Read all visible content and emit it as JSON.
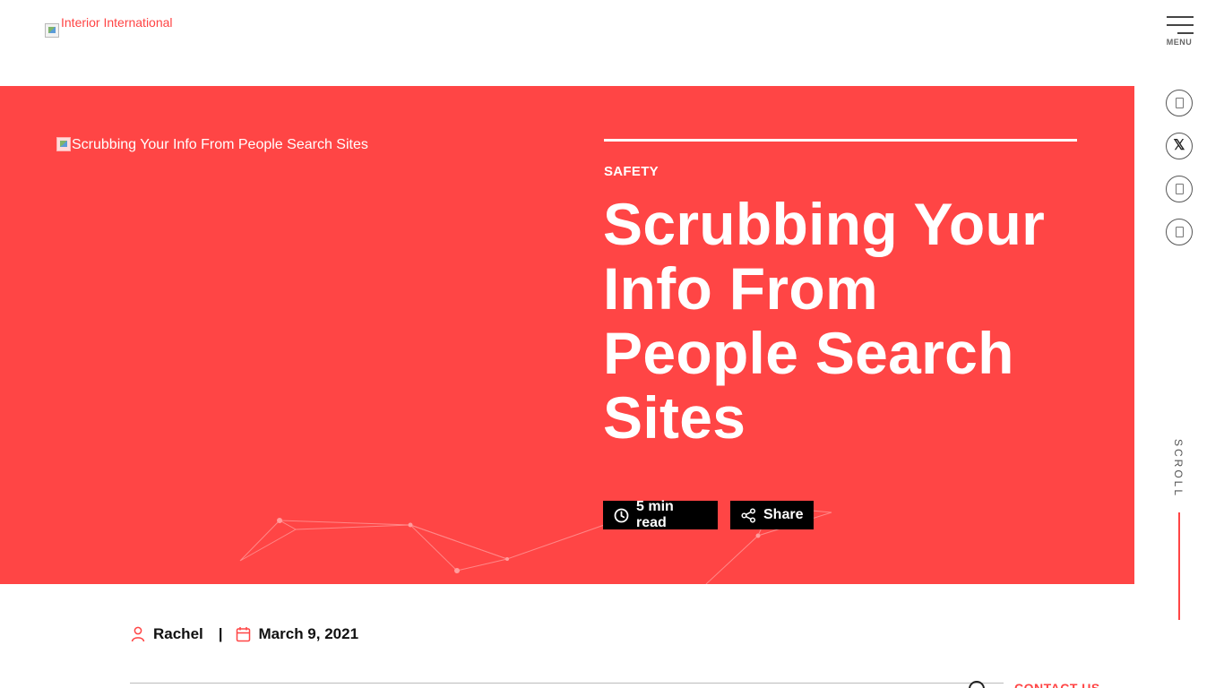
{
  "header": {
    "logo_alt": "Interior International",
    "menu_label": "MENU"
  },
  "hero": {
    "image_alt": "Scrubbing Your Info From People Search Sites",
    "category": "SAFETY",
    "title": "Scrubbing Your Info From People Search Sites",
    "read_time": "5 min read",
    "share_label": "Share"
  },
  "social": [
    "facebook-icon",
    "x-twitter-icon",
    "linkedin-icon",
    "email-icon"
  ],
  "scroll_label": "SCROLL",
  "meta": {
    "author": "Rachel",
    "separator": "|",
    "date": "March 9, 2021"
  },
  "footer_peek": {
    "contact_label": "CONTACT US"
  },
  "colors": {
    "accent": "#ff4545",
    "chip_bg": "#000000",
    "text": "#111111"
  }
}
